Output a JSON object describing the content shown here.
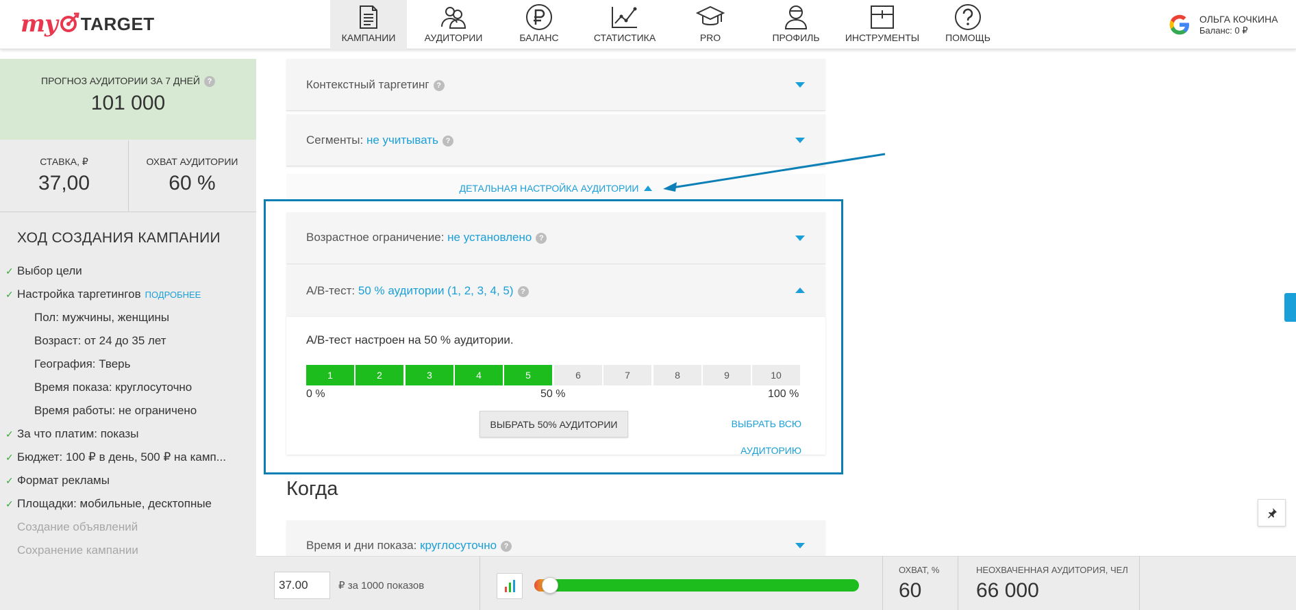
{
  "brand": {
    "my": "my",
    "target": "TARGET"
  },
  "nav": [
    {
      "id": "campaigns",
      "label": "КАМПАНИИ",
      "icon": "document-icon",
      "active": true
    },
    {
      "id": "audiences",
      "label": "АУДИТОРИИ",
      "icon": "people-icon"
    },
    {
      "id": "balance",
      "label": "БАЛАНС",
      "icon": "ruble-icon"
    },
    {
      "id": "statistics",
      "label": "СТАТИСТИКА",
      "icon": "line-chart-icon"
    },
    {
      "id": "pro",
      "label": "PRO",
      "icon": "graduation-cap-icon"
    },
    {
      "id": "profile",
      "label": "ПРОФИЛЬ",
      "icon": "user-icon"
    },
    {
      "id": "tools",
      "label": "ИНСТРУМЕНТЫ",
      "icon": "toolbox-icon"
    },
    {
      "id": "help",
      "label": "ПОМОЩЬ",
      "icon": "question-icon"
    }
  ],
  "user": {
    "name": "ОЛЬГА КОЧКИНА",
    "balance": "Баланс: 0 ₽",
    "provider_icon": "google-icon"
  },
  "sidebar": {
    "forecast_label": "ПРОГНОЗ АУДИТОРИИ ЗА 7 ДНЕЙ",
    "forecast_value": "101 000",
    "bid_label": "СТАВКА, ₽",
    "bid_value": "37,00",
    "reach_label": "ОХВАТ АУДИТОРИИ",
    "reach_value": "60 %",
    "steps_title": "ХОД СОЗДАНИЯ КАМПАНИИ",
    "more_link": "ПОДРОБНЕЕ",
    "steps": [
      {
        "text": "Выбор цели",
        "done": true
      },
      {
        "text": "Настройка таргетингов",
        "done": true,
        "link": true
      },
      {
        "text": "Пол: мужчины, женщины",
        "sub": true
      },
      {
        "text": "Возраст: от 24 до 35 лет",
        "sub": true
      },
      {
        "text": "География: Тверь",
        "sub": true
      },
      {
        "text": "Время показа: круглосуточно",
        "sub": true
      },
      {
        "text": "Время работы: не ограничено",
        "sub": true
      },
      {
        "text": "За что платим: показы",
        "done": true
      },
      {
        "text": "Бюджет: 100 ₽ в день, 500 ₽ на камп...",
        "done": true
      },
      {
        "text": "Формат рекламы",
        "done": true
      },
      {
        "text": "Площадки: мобильные, десктопные",
        "done": true
      },
      {
        "text": "Создание объявлений",
        "muted": true
      },
      {
        "text": "Сохранение кампании",
        "muted": true
      }
    ]
  },
  "content": {
    "context_targeting": "Контекстный таргетинг",
    "segments_label": "Сегменты:",
    "segments_value": "не учитывать",
    "detail_link": "ДЕТАЛЬНАЯ НАСТРОЙКА АУДИТОРИИ",
    "age_label": "Возрастное ограничение:",
    "age_value": "не установлено",
    "ab_label": "A/B-тест:",
    "ab_value": "50 % аудитории (1, 2, 3, 4, 5)",
    "ab_desc": "A/B-тест настроен на 50 % аудитории.",
    "segments": [
      "1",
      "2",
      "3",
      "4",
      "5",
      "6",
      "7",
      "8",
      "9",
      "10"
    ],
    "selected_count": 5,
    "scale_left": "0 %",
    "scale_mid": "50 %",
    "scale_right": "100 %",
    "btn_select_50": "ВЫБРАТЬ 50% АУДИТОРИИ",
    "btn_select_all": "ВЫБРАТЬ ВСЮ АУДИТОРИЮ",
    "when_title": "Когда",
    "time_label": "Время и дни показа:",
    "time_value": "круглосуточно"
  },
  "bottom": {
    "bid_value": "37.00",
    "bid_unit": "₽ за 1000 показов",
    "reach_label": "ОХВАТ, %",
    "reach_value": "60",
    "unreached_label": "НЕОХВАЧЕННАЯ АУДИТОРИЯ, ЧЕЛ",
    "unreached_value": "66 000"
  },
  "colors": {
    "accent": "#1a9fd8",
    "green": "#1ebd1e",
    "highlight": "#0b7fb6",
    "forecast_bg": "#d7e9d3"
  }
}
